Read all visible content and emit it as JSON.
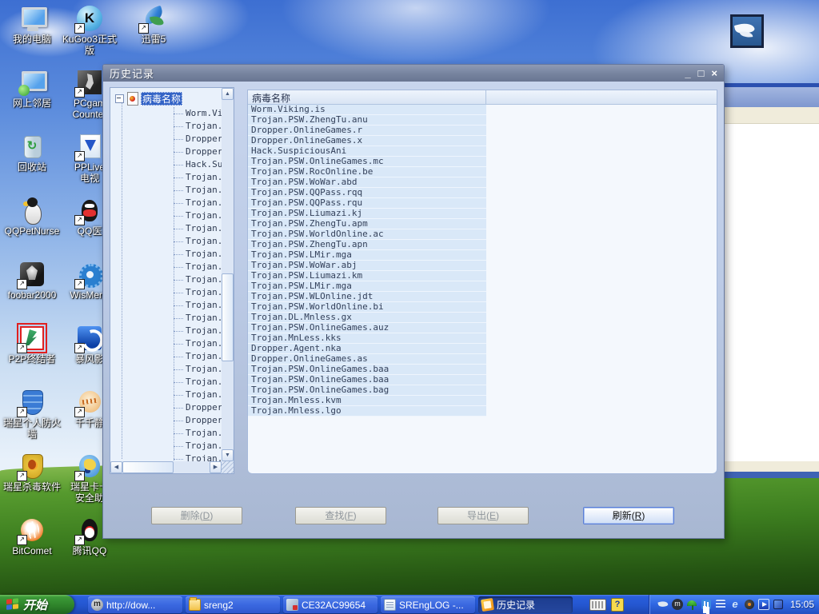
{
  "colors": {
    "taskbar_blue": "#2456cf",
    "taskbar_active_task": "#1c3c8e",
    "dialog_titlebar": "#76839e",
    "dialog_body": "#bccbe6",
    "tree_selection": "#3363c6",
    "list_row_blue": "#d9e8f8",
    "default_button_border": "#5a7ed8",
    "grass_green": "#3c7d1f"
  },
  "desktop": {
    "columns": [
      {
        "items": [
          {
            "id": "my-computer",
            "icon": "my-computer-icon",
            "lines": [
              "我的电脑"
            ],
            "shortcut": false,
            "selected": false
          },
          {
            "id": "network-places",
            "icon": "network-icon",
            "lines": [
              "网上邻居"
            ],
            "shortcut": false,
            "selected": false
          },
          {
            "id": "recycle-bin",
            "icon": "recycle-bin-icon",
            "lines": [
              "回收站"
            ],
            "shortcut": false,
            "selected": false
          },
          {
            "id": "qqpetnurse",
            "icon": "qqpet-icon",
            "lines": [
              "QQPetNurse"
            ],
            "shortcut": false,
            "selected": false
          },
          {
            "id": "foobar2000",
            "icon": "foobar-icon",
            "lines": [
              "foobar2000"
            ],
            "shortcut": true,
            "selected": false
          },
          {
            "id": "p2p-terminator",
            "icon": "p2p-icon",
            "lines": [
              "P2P终结者"
            ],
            "shortcut": true,
            "selected": true
          },
          {
            "id": "rising-firewall",
            "icon": "firewall-icon",
            "lines": [
              "瑞星个人防火",
              "墙"
            ],
            "shortcut": true,
            "selected": false
          },
          {
            "id": "rising-antivirus",
            "icon": "rav-icon",
            "lines": [
              "瑞星杀毒软件"
            ],
            "shortcut": true,
            "selected": false
          },
          {
            "id": "bitcomet",
            "icon": "bitcomet-icon",
            "lines": [
              "BitComet"
            ],
            "shortcut": true,
            "selected": false
          }
        ]
      },
      {
        "items": [
          {
            "id": "kugoo3",
            "icon": "kugoo-icon",
            "lines": [
              "KuGoo3正式版"
            ],
            "shortcut": true,
            "selected": false
          },
          {
            "id": "pcgame-counter",
            "icon": "csgame-icon",
            "lines": [
              "PCgam",
              "Counter"
            ],
            "shortcut": true,
            "selected": false
          },
          {
            "id": "pplive",
            "icon": "pplive-icon",
            "lines": [
              "PPLive",
              "电视"
            ],
            "shortcut": true,
            "selected": false
          },
          {
            "id": "qq-doctor",
            "icon": "qqdoctor-icon",
            "lines": [
              "QQ医"
            ],
            "shortcut": true,
            "selected": false
          },
          {
            "id": "wismencoder",
            "icon": "wismencoder-icon",
            "lines": [
              "WisMenc"
            ],
            "shortcut": true,
            "selected": false
          },
          {
            "id": "storm-player",
            "icon": "stormplayer-icon",
            "lines": [
              "暴风影"
            ],
            "shortcut": true,
            "selected": false
          },
          {
            "id": "ttplayer",
            "icon": "ttplayer-icon",
            "lines": [
              "千千静"
            ],
            "shortcut": true,
            "selected": false
          },
          {
            "id": "rising-kaka",
            "icon": "kaka-icon",
            "lines": [
              "瑞星卡卡",
              "安全助"
            ],
            "shortcut": true,
            "selected": false
          },
          {
            "id": "tencent-qq",
            "icon": "qq-icon",
            "lines": [
              "腾讯QQ"
            ],
            "shortcut": true,
            "selected": false
          }
        ]
      },
      {
        "items": [
          {
            "id": "thunder5",
            "icon": "thunder-icon",
            "lines": [
              "迅雷5"
            ],
            "shortcut": true,
            "selected": false
          }
        ]
      }
    ]
  },
  "dialog": {
    "title": "历史记录",
    "window_buttons": {
      "minimize": "_",
      "maximize": "□",
      "close": "×"
    },
    "tree": {
      "root_label": "病毒名称"
    },
    "list": {
      "header": "病毒名称"
    },
    "virus_names": [
      "Worm.Viking.is",
      "Trojan.PSW.ZhengTu.anu",
      "Dropper.OnlineGames.r",
      "Dropper.OnlineGames.x",
      "Hack.SuspiciousAni",
      "Trojan.PSW.OnlineGames.mc",
      "Trojan.PSW.RocOnline.be",
      "Trojan.PSW.WoWar.abd",
      "Trojan.PSW.QQPass.rqq",
      "Trojan.PSW.QQPass.rqu",
      "Trojan.PSW.Liumazi.kj",
      "Trojan.PSW.ZhengTu.apm",
      "Trojan.PSW.WorldOnline.ac",
      "Trojan.PSW.ZhengTu.apn",
      "Trojan.PSW.LMir.mga",
      "Trojan.PSW.WoWar.abj",
      "Trojan.PSW.Liumazi.km",
      "Trojan.PSW.LMir.mga",
      "Trojan.PSW.WLOnline.jdt",
      "Trojan.PSW.WorldOnline.bi",
      "Trojan.DL.Mnless.gx",
      "Trojan.PSW.OnlineGames.auz",
      "Trojan.MnLess.kks",
      "Dropper.Agent.nka",
      "Dropper.OnlineGames.as",
      "Trojan.PSW.OnlineGames.baa",
      "Trojan.PSW.OnlineGames.baa",
      "Trojan.PSW.OnlineGames.bag",
      "Trojan.Mnless.kvm",
      "Trojan.Mnless.lgo"
    ],
    "buttons": [
      {
        "id": "delete",
        "label": "删除(D)",
        "enabled": false
      },
      {
        "id": "find",
        "label": "查找(F)",
        "enabled": false
      },
      {
        "id": "export",
        "label": "导出(E)",
        "enabled": false
      },
      {
        "id": "refresh",
        "label": "刷新(R)",
        "enabled": true
      }
    ]
  },
  "taskbar": {
    "start_label": "开始",
    "tasks": [
      {
        "id": "browser",
        "icon": "maxthon-task-icon",
        "label": "http://dow...",
        "active": false
      },
      {
        "id": "sreng2-folder",
        "icon": "folder-task-icon",
        "label": "sreng2",
        "active": false
      },
      {
        "id": "ce32ac99654",
        "icon": "app-task-icon",
        "label": "CE32AC99654",
        "active": false
      },
      {
        "id": "srenglog",
        "icon": "notepad-task-icon",
        "label": "SREngLOG -...",
        "active": false
      },
      {
        "id": "history",
        "icon": "history-task-icon",
        "label": "历史记录",
        "active": true
      }
    ],
    "language_bar": {
      "help_glyph": "?"
    },
    "tray": {
      "icons": [
        {
          "id": "thunder-tray-icon"
        },
        {
          "id": "maxthon-tray-icon"
        },
        {
          "id": "rising-umbrella-tray-icon"
        },
        {
          "id": "music-tray-icon"
        },
        {
          "id": "firewall-tray-icon"
        },
        {
          "id": "ie-tray-icon"
        },
        {
          "id": "speaker-tray-icon"
        },
        {
          "id": "play-tray-icon"
        },
        {
          "id": "display-tray-icon"
        }
      ],
      "clock": "15:05"
    }
  }
}
